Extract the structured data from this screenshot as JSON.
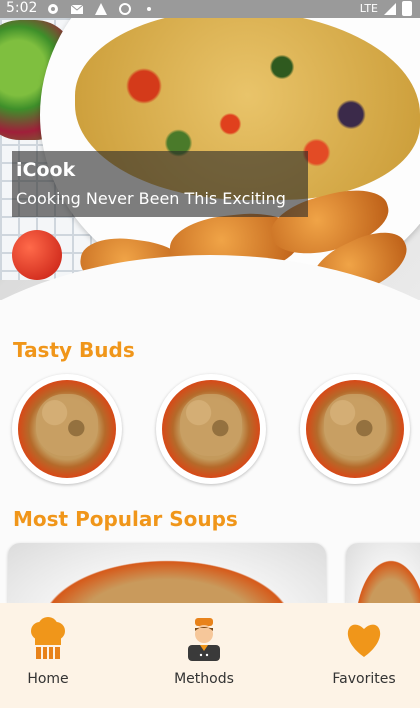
{
  "status_bar": {
    "time": "5:02",
    "network": "LTE",
    "icons": [
      "settings-icon",
      "mail-icon",
      "warning-icon",
      "sync-icon",
      "dot-icon",
      "signal-icon",
      "battery-icon"
    ]
  },
  "hero": {
    "title": "iCook",
    "subtitle": "Cooking Never Been This Exciting"
  },
  "sections": {
    "tasty_buds": {
      "title": "Tasty Buds",
      "items": [
        "soup-1",
        "soup-2",
        "soup-3"
      ]
    },
    "popular_soups": {
      "title": "Most Popular Soups"
    }
  },
  "bottom_nav": {
    "items": [
      {
        "label": "Home",
        "icon": "chef-hat-icon"
      },
      {
        "label": "Methods",
        "icon": "chef-icon"
      },
      {
        "label": "Favorites",
        "icon": "heart-icon"
      }
    ]
  },
  "colors": {
    "accent": "#f0961a",
    "status_bar": "#9a9a9a",
    "nav_bg": "#fdf3e6"
  }
}
